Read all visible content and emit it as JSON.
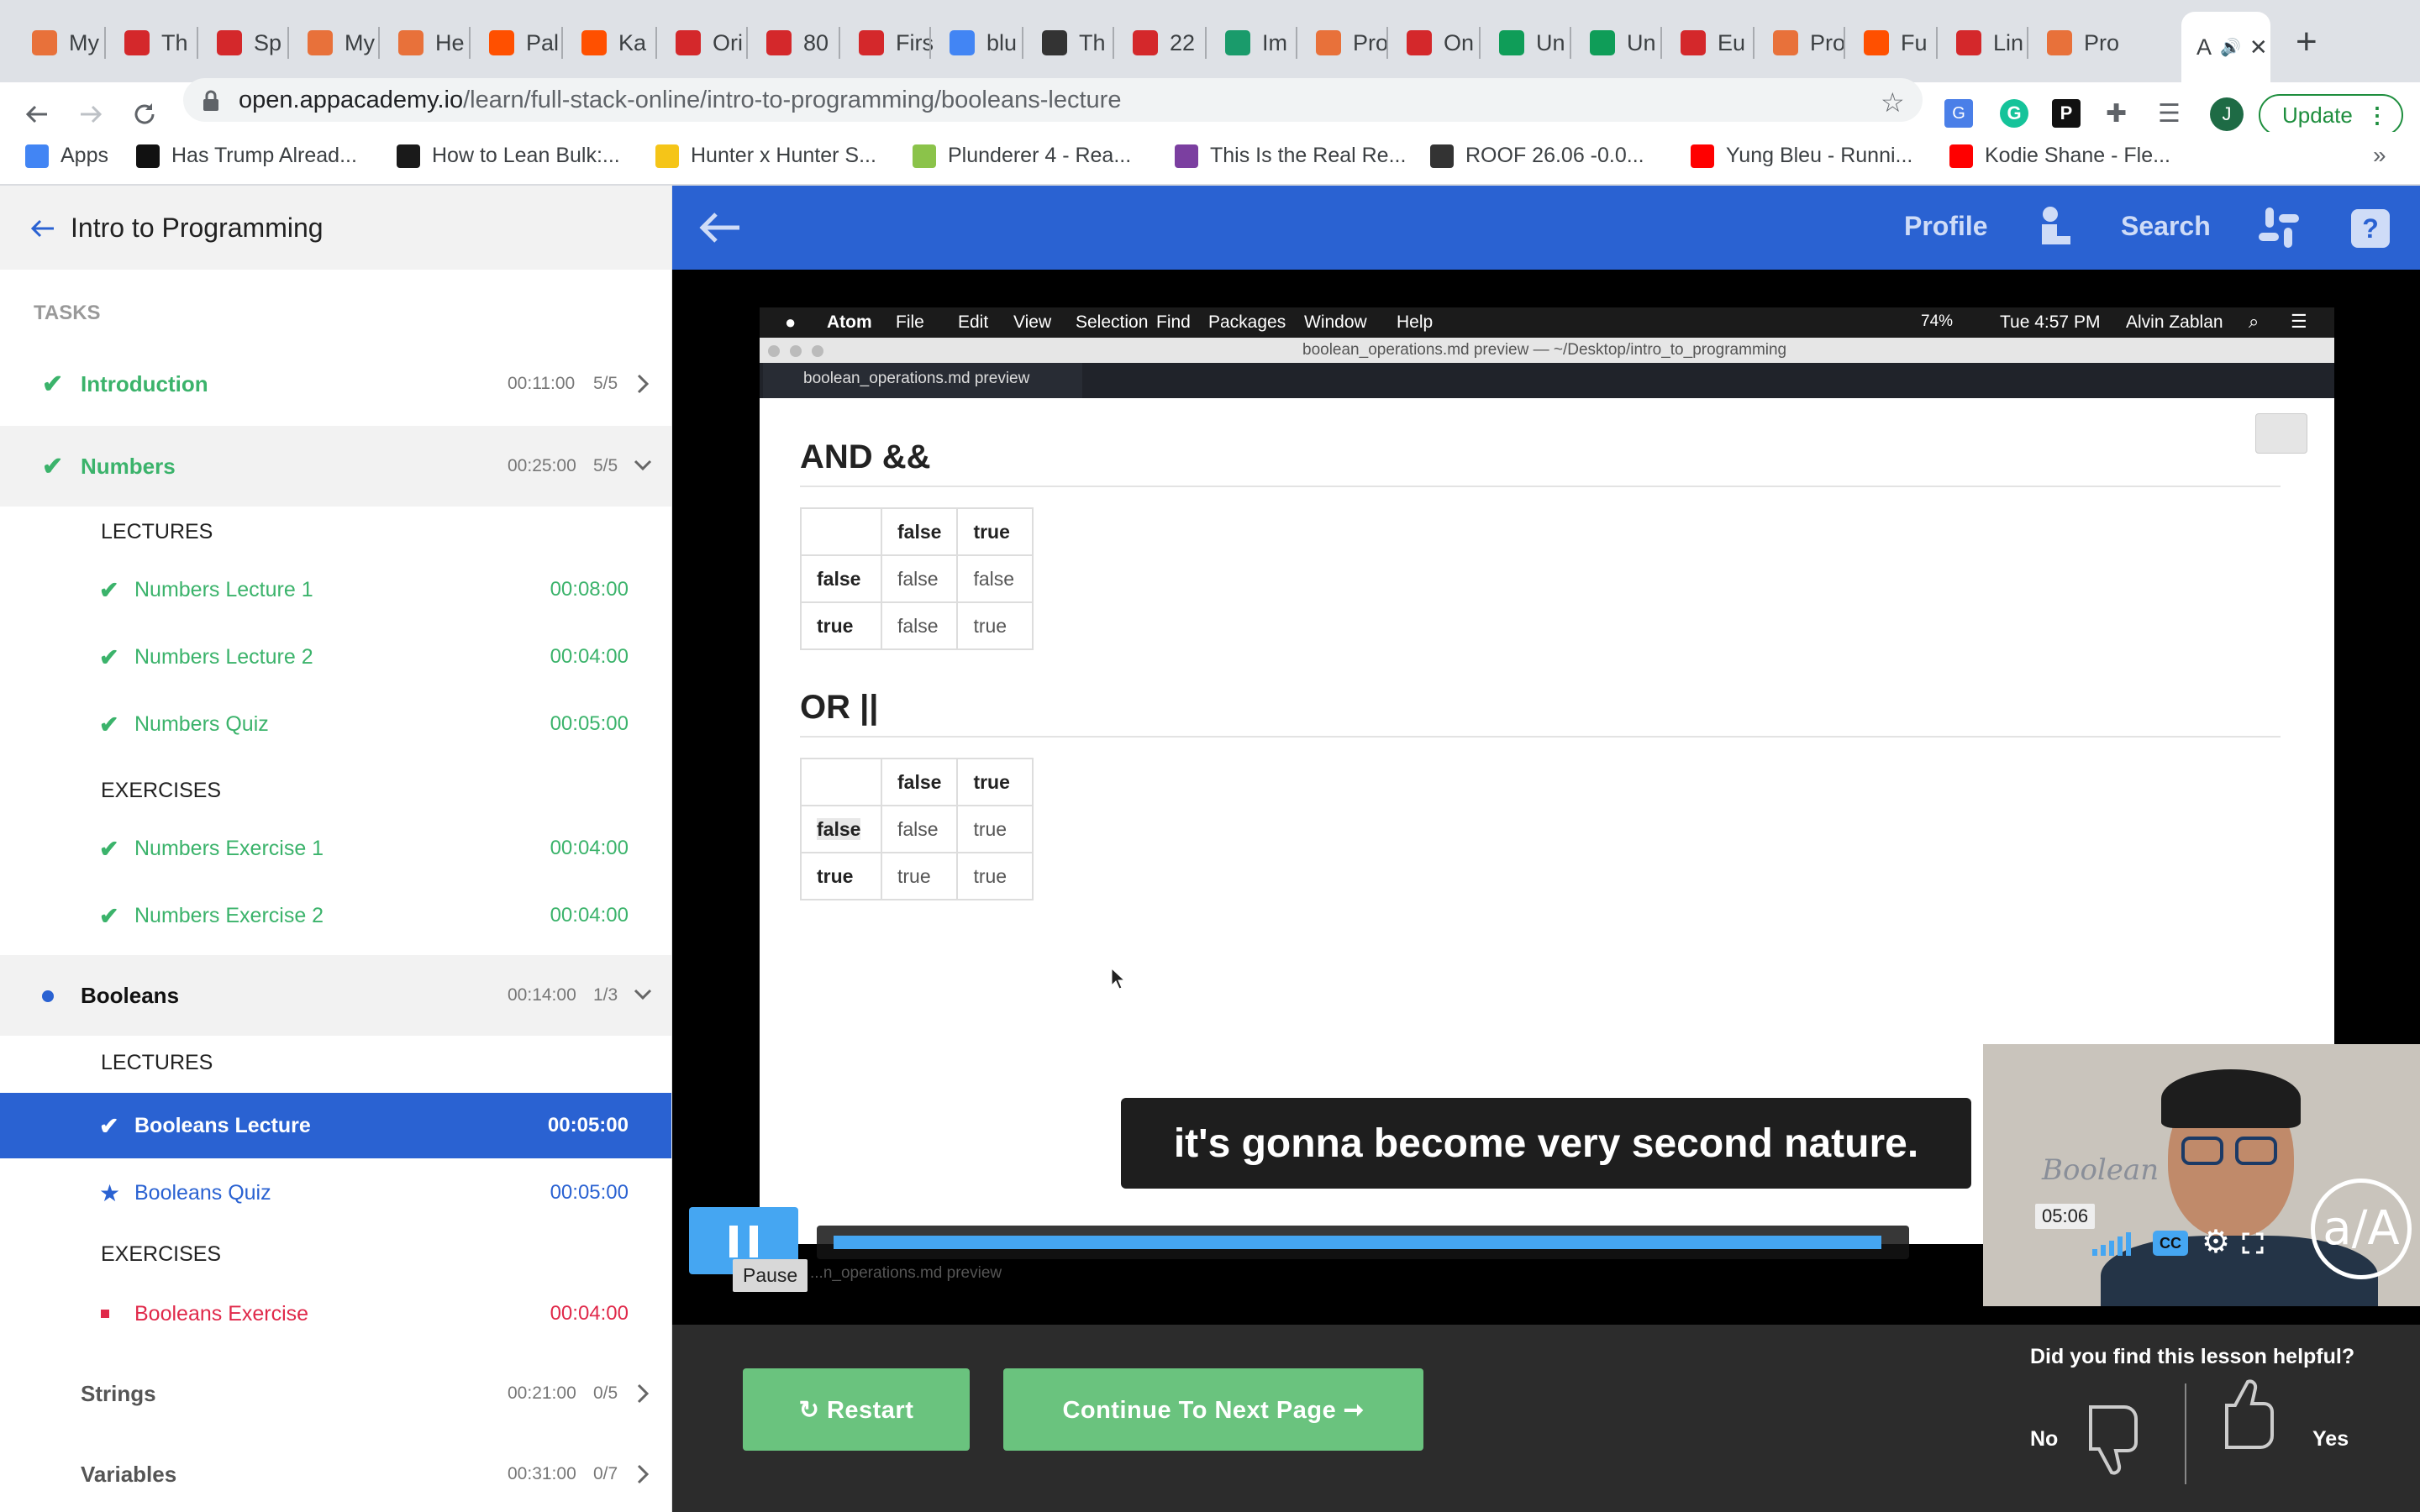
{
  "browser": {
    "tabs": [
      {
        "label": "My",
        "color": "#e8713a"
      },
      {
        "label": "Th",
        "color": "#d4282b"
      },
      {
        "label": "Sp",
        "color": "#d4282b"
      },
      {
        "label": "My",
        "color": "#e8713a"
      },
      {
        "label": "He",
        "color": "#e8713a"
      },
      {
        "label": "Pal",
        "color": "#ff5000"
      },
      {
        "label": "Ka",
        "color": "#ff5000"
      },
      {
        "label": "Ori",
        "color": "#d4282b"
      },
      {
        "label": "80",
        "color": "#d4282b"
      },
      {
        "label": "Firs",
        "color": "#d4282b"
      },
      {
        "label": "blu",
        "color": "#4285f4"
      },
      {
        "label": "Th",
        "color": "#333333"
      },
      {
        "label": "22",
        "color": "#d4282b"
      },
      {
        "label": "Im",
        "color": "#1a9b6b"
      },
      {
        "label": "Pro",
        "color": "#e8713a"
      },
      {
        "label": "On",
        "color": "#d4282b"
      },
      {
        "label": "Un",
        "color": "#0f9d58"
      },
      {
        "label": "Un",
        "color": "#0f9d58"
      },
      {
        "label": "Eu",
        "color": "#d4282b"
      },
      {
        "label": "Pro",
        "color": "#e8713a"
      },
      {
        "label": "Fu",
        "color": "#ff5000"
      },
      {
        "label": "Lin",
        "color": "#d4282b"
      },
      {
        "label": "Pro",
        "color": "#e8713a"
      }
    ],
    "active_tab_label": "A",
    "new_tab": "+",
    "url_host": "open.appacademy.io",
    "url_path": "/learn/full-stack-online/intro-to-programming/booleans-lecture",
    "update_label": "Update",
    "profile_initial": "J",
    "bookmarks": [
      {
        "label": "Apps",
        "color": "#4285f4"
      },
      {
        "label": "Has Trump Alread...",
        "color": "#111111"
      },
      {
        "label": "How to Lean Bulk:...",
        "color": "#1a1a1a"
      },
      {
        "label": "Hunter x Hunter S...",
        "color": "#f5c518"
      },
      {
        "label": "Plunderer 4 - Rea...",
        "color": "#8bc34a"
      },
      {
        "label": "This Is the Real Re...",
        "color": "#7b3fa0"
      },
      {
        "label": "ROOF 26.06 -0.0...",
        "color": "#333333"
      },
      {
        "label": "Yung Bleu - Runni...",
        "color": "#ff0000"
      },
      {
        "label": "Kodie Shane - Fle...",
        "color": "#ff0000"
      }
    ],
    "more_bookmarks": "»"
  },
  "sidebar": {
    "back_title": "Intro to Programming",
    "tasks_label": "TASKS",
    "sections": [
      {
        "name": "Introduction",
        "time": "00:11:00",
        "count": "5/5"
      },
      {
        "name": "Numbers",
        "time": "00:25:00",
        "count": "5/5"
      },
      {
        "name": "Booleans",
        "time": "00:14:00",
        "count": "1/3"
      },
      {
        "name": "Strings",
        "time": "00:21:00",
        "count": "0/5"
      },
      {
        "name": "Variables",
        "time": "00:31:00",
        "count": "0/7"
      }
    ],
    "numbers_lectures_label": "LECTURES",
    "numbers_lectures": [
      {
        "label": "Numbers Lecture 1",
        "time": "00:08:00"
      },
      {
        "label": "Numbers Lecture 2",
        "time": "00:04:00"
      },
      {
        "label": "Numbers Quiz",
        "time": "00:05:00"
      }
    ],
    "numbers_exercises_label": "EXERCISES",
    "numbers_exercises": [
      {
        "label": "Numbers Exercise 1",
        "time": "00:04:00"
      },
      {
        "label": "Numbers Exercise 2",
        "time": "00:04:00"
      }
    ],
    "booleans_lectures_label": "LECTURES",
    "booleans_lecture": {
      "label": "Booleans Lecture",
      "time": "00:05:00"
    },
    "booleans_quiz": {
      "label": "Booleans Quiz",
      "time": "00:05:00"
    },
    "booleans_exercises_label": "EXERCISES",
    "booleans_exercise": {
      "label": "Booleans Exercise",
      "time": "00:04:00"
    }
  },
  "topnav": {
    "profile": "Profile",
    "search": "Search",
    "help": "?"
  },
  "video": {
    "mac_menu": [
      "Atom",
      "File",
      "Edit",
      "View",
      "Selection",
      "Find",
      "Packages",
      "Window",
      "Help"
    ],
    "battery": "74%",
    "clock": "Tue 4:57 PM",
    "user": "Alvin Zablan",
    "window_title": "boolean_operations.md preview — ~/Desktop/intro_to_programming",
    "tab_title": "boolean_operations.md preview",
    "and_heading": "AND &&",
    "or_heading": "OR ||",
    "col_headers": [
      "false",
      "true"
    ],
    "and_rows": [
      {
        "head": "false",
        "cells": [
          "false",
          "false"
        ]
      },
      {
        "head": "true",
        "cells": [
          "false",
          "true"
        ]
      }
    ],
    "or_rows": [
      {
        "head": "false",
        "cells": [
          "false",
          "true"
        ]
      },
      {
        "head": "true",
        "cells": [
          "true",
          "true"
        ]
      }
    ],
    "caption": "it's gonna become very second nature.",
    "time_tooltip": "05:06",
    "pause_tooltip": "Pause",
    "faded_tab": "...n_operations.md preview",
    "whiteboard": "Boolean",
    "progress": 0.99,
    "cc": "CC",
    "logo": "a/A"
  },
  "footer": {
    "restart": "↻ Restart",
    "continue": "Continue To Next Page ➞",
    "question": "Did you find this lesson helpful?",
    "no": "No",
    "yes": "Yes"
  },
  "colors": {
    "accent_blue": "#2a62d2",
    "done_green": "#3bb36b",
    "todo_red": "#e0294a"
  }
}
